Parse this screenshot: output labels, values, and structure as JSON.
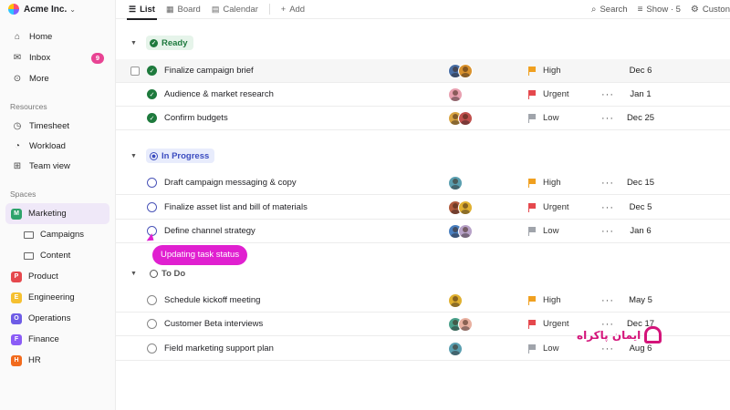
{
  "workspace": {
    "name": "Acme Inc."
  },
  "sidebar": {
    "top_items": [
      {
        "label": "Home",
        "icon": "home-icon"
      },
      {
        "label": "Inbox",
        "icon": "inbox-icon",
        "badge": "9"
      },
      {
        "label": "More",
        "icon": "more-icon"
      }
    ],
    "resources_title": "Resources",
    "resources": [
      {
        "label": "Timesheet",
        "icon": "clock-icon"
      },
      {
        "label": "Workload",
        "icon": "gauge-icon"
      },
      {
        "label": "Team view",
        "icon": "grid-icon"
      }
    ],
    "spaces_title": "Spaces",
    "spaces": [
      {
        "letter": "M",
        "label": "Marketing",
        "color": "#2ea36b",
        "active": true
      },
      {
        "letter": "P",
        "label": "Product",
        "color": "#e5484d"
      },
      {
        "letter": "E",
        "label": "Engineering",
        "color": "#f5c030"
      },
      {
        "letter": "O",
        "label": "Operations",
        "color": "#6e5ce6"
      },
      {
        "letter": "F",
        "label": "Finance",
        "color": "#8b5cf6"
      },
      {
        "letter": "H",
        "label": "HR",
        "color": "#f26b1d"
      }
    ],
    "folders": [
      {
        "label": "Campaigns"
      },
      {
        "label": "Content"
      }
    ]
  },
  "toolbar": {
    "tabs": [
      {
        "label": "List",
        "icon": "list-icon",
        "active": true
      },
      {
        "label": "Board",
        "icon": "board-icon"
      },
      {
        "label": "Calendar",
        "icon": "calendar-icon"
      }
    ],
    "add_label": "Add",
    "search_label": "Search",
    "show_label": "Show · 5",
    "customize_label": "Custon"
  },
  "groups": [
    {
      "label": "Ready",
      "color": "#1e7a3d",
      "bg": "#e6f4ea",
      "tasks": [
        {
          "name": "Finalize campaign brief",
          "status": "done",
          "priority": "High",
          "date": "Dec 6",
          "avatars": [
            "#4a6fa5",
            "#d9922e"
          ],
          "hover": true
        },
        {
          "name": "Audience & market research",
          "status": "done",
          "priority": "Urgent",
          "date": "Jan 1",
          "avatars": [
            "#e8a0b0"
          ],
          "more": true
        },
        {
          "name": "Confirm budgets",
          "status": "done",
          "priority": "Low",
          "date": "Dec 25",
          "avatars": [
            "#d9a441",
            "#c0504d"
          ],
          "more": true
        }
      ]
    },
    {
      "label": "In Progress",
      "color": "#3b4cc0",
      "bg": "#e8ecfc",
      "tasks": [
        {
          "name": "Draft campaign messaging & copy",
          "status": "open",
          "priority": "High",
          "date": "Dec 15",
          "avatars": [
            "#5a9fb0"
          ],
          "more": true
        },
        {
          "name": "Finalize asset list and bill of materials",
          "status": "open",
          "priority": "Urgent",
          "date": "Dec 5",
          "avatars": [
            "#b05a3c",
            "#e0b030"
          ],
          "more": true
        },
        {
          "name": "Define channel strategy",
          "status": "open",
          "priority": "Low",
          "date": "Jan 6",
          "avatars": [
            "#4a7fbf",
            "#b8a2c8"
          ],
          "more": true
        }
      ]
    },
    {
      "label": "To Do",
      "color": "#555555",
      "bg": "transparent",
      "tasks": [
        {
          "name": "Schedule kickoff meeting",
          "status": "todo",
          "priority": "High",
          "date": "May 5",
          "avatars": [
            "#e0b030"
          ],
          "more": true
        },
        {
          "name": "Customer Beta interviews",
          "status": "todo",
          "priority": "Urgent",
          "date": "Dec 17",
          "avatars": [
            "#4aa08a",
            "#e8b0a0"
          ],
          "more": true
        },
        {
          "name": "Field marketing support plan",
          "status": "todo",
          "priority": "Low",
          "date": "Aug 6",
          "avatars": [
            "#5a9fb0"
          ],
          "more": true
        }
      ]
    }
  ],
  "priority_colors": {
    "High": "#f0a020",
    "Urgent": "#e5484d",
    "Low": "#a0a4ab"
  },
  "tooltip": "Updating task status",
  "watermark": "ایمان پاکراه"
}
